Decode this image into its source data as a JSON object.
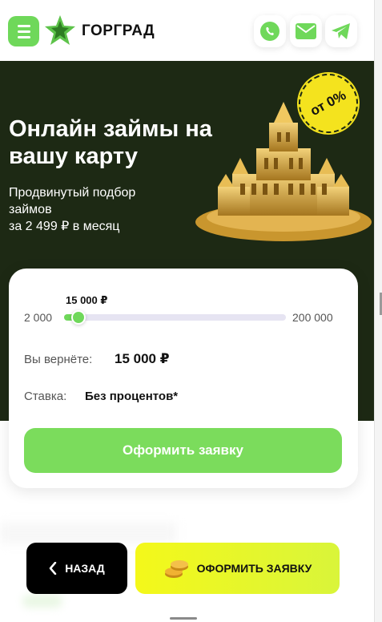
{
  "header": {
    "logo_text": "ГОРГРАД",
    "icons": [
      "menu-icon",
      "whatsapp-icon",
      "mail-icon",
      "telegram-icon"
    ]
  },
  "hero": {
    "title": "Онлайн займы на вашу карту",
    "subtitle_line1": "Продвинутый подбор займов",
    "subtitle_line2": "за 2 499 ₽ в месяц",
    "badge": "от 0%"
  },
  "calculator": {
    "current_value": "15 000 ₽",
    "min_label": "2 000",
    "max_label": "200 000",
    "slider_fraction": 0.066,
    "return_label": "Вы вернёте:",
    "return_value": "15 000 ₽",
    "rate_label": "Ставка:",
    "rate_value": "Без процентов*",
    "submit_label": "Оформить заявку"
  },
  "bottom": {
    "back_label": "НАЗАД",
    "apply_label": "ОФОРМИТЬ ЗАЯВКУ"
  },
  "colors": {
    "accent_green": "#6fd85a",
    "hero_bg": "#1d2914",
    "badge_yellow": "#f4e31e"
  }
}
